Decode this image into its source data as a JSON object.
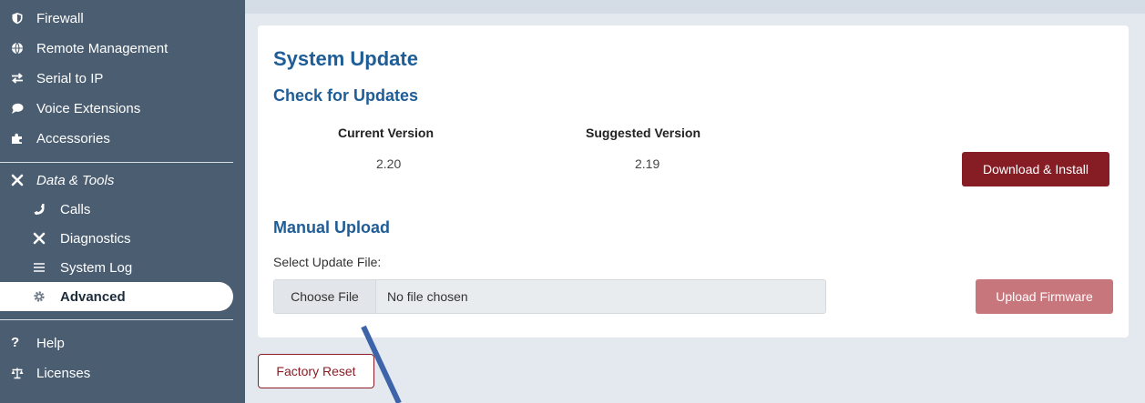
{
  "sidebar": {
    "items": [
      {
        "label": "Firewall",
        "icon": "shield-icon"
      },
      {
        "label": "Remote Management",
        "icon": "globe-icon"
      },
      {
        "label": "Serial to IP",
        "icon": "arrows-exchange-icon"
      },
      {
        "label": "Voice Extensions",
        "icon": "chat-bubble-icon"
      },
      {
        "label": "Accessories",
        "icon": "puzzle-icon"
      }
    ],
    "section": {
      "label": "Data & Tools",
      "icon": "tools-icon"
    },
    "tools": [
      {
        "label": "Calls",
        "icon": "phone-icon"
      },
      {
        "label": "Diagnostics",
        "icon": "tools-icon"
      },
      {
        "label": "System Log",
        "icon": "list-icon"
      },
      {
        "label": "Advanced",
        "icon": "gear-icon",
        "active": true
      }
    ],
    "bottom": [
      {
        "label": "Help",
        "icon": "question-icon"
      },
      {
        "label": "Licenses",
        "icon": "scales-icon"
      }
    ]
  },
  "main": {
    "title": "System Update",
    "check": {
      "heading": "Check for Updates",
      "current_label": "Current Version",
      "current_value": "2.20",
      "suggested_label": "Suggested Version",
      "suggested_value": "2.19",
      "download_button": "Download & Install"
    },
    "manual": {
      "heading": "Manual Upload",
      "field_label": "Select Update File:",
      "choose_button": "Choose File",
      "no_file": "No file chosen",
      "upload_button": "Upload Firmware"
    },
    "factory_reset_button": "Factory Reset"
  },
  "colors": {
    "sidebar_bg": "#4a5d71",
    "heading": "#1f5d97",
    "primary_button": "#861d25",
    "disabled_button": "#c7767c",
    "annotation_arrow": "#3d63a8"
  }
}
